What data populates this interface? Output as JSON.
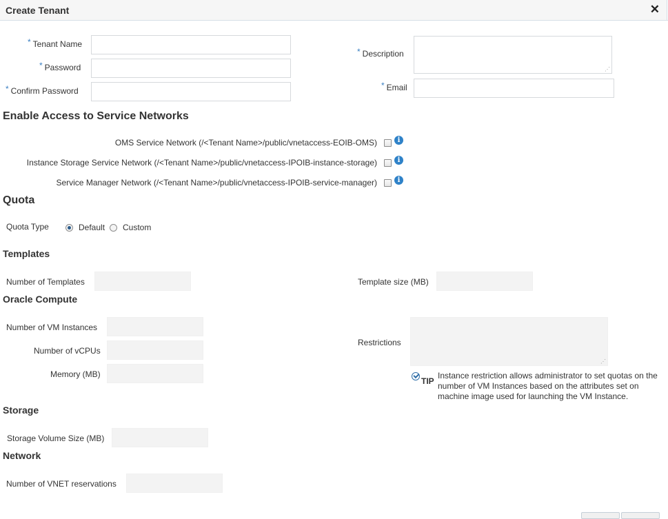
{
  "dialog": {
    "title": "Create Tenant"
  },
  "form": {
    "tenant_name_label": "Tenant Name",
    "password_label": "Password",
    "confirm_password_label": "Confirm Password",
    "description_label": "Description",
    "email_label": "Email",
    "required_marker": "*"
  },
  "networks": {
    "heading": "Enable Access to Service Networks",
    "items": [
      {
        "label": "OMS Service Network (/<Tenant Name>/public/vnetaccess-EOIB-OMS)",
        "checked": false
      },
      {
        "label": "Instance Storage Service Network (/<Tenant Name>/public/vnetaccess-IPOIB-instance-storage)",
        "checked": false
      },
      {
        "label": "Service Manager Network (/<Tenant Name>/public/vnetaccess-IPOIB-service-manager)",
        "checked": false
      }
    ]
  },
  "quota": {
    "heading": "Quota",
    "type_label": "Quota Type",
    "options": [
      "Default",
      "Custom"
    ],
    "selected": "Default"
  },
  "templates": {
    "heading": "Templates",
    "number_label": "Number of Templates",
    "size_label": "Template size (MB)"
  },
  "compute": {
    "heading": "Oracle Compute",
    "vm_label": "Number of VM Instances",
    "vcpu_label": "Number of vCPUs",
    "memory_label": "Memory (MB)",
    "restrictions_label": "Restrictions",
    "tip_label": "TIP",
    "tip_text": "Instance restriction allows administrator to set quotas on the number of VM Instances based on the attributes set on machine image used for launching the VM Instance."
  },
  "storage": {
    "heading": "Storage",
    "volume_label": "Storage Volume Size (MB)"
  },
  "network": {
    "heading": "Network",
    "vnet_label": "Number of VNET reservations"
  },
  "colors": {
    "accent": "#2f82c8",
    "required": "#3a7fc2",
    "titlebar": "#f6f6f6"
  },
  "icons": {
    "close": "close-icon",
    "info": "info-icon",
    "tip": "tip-check-icon"
  }
}
